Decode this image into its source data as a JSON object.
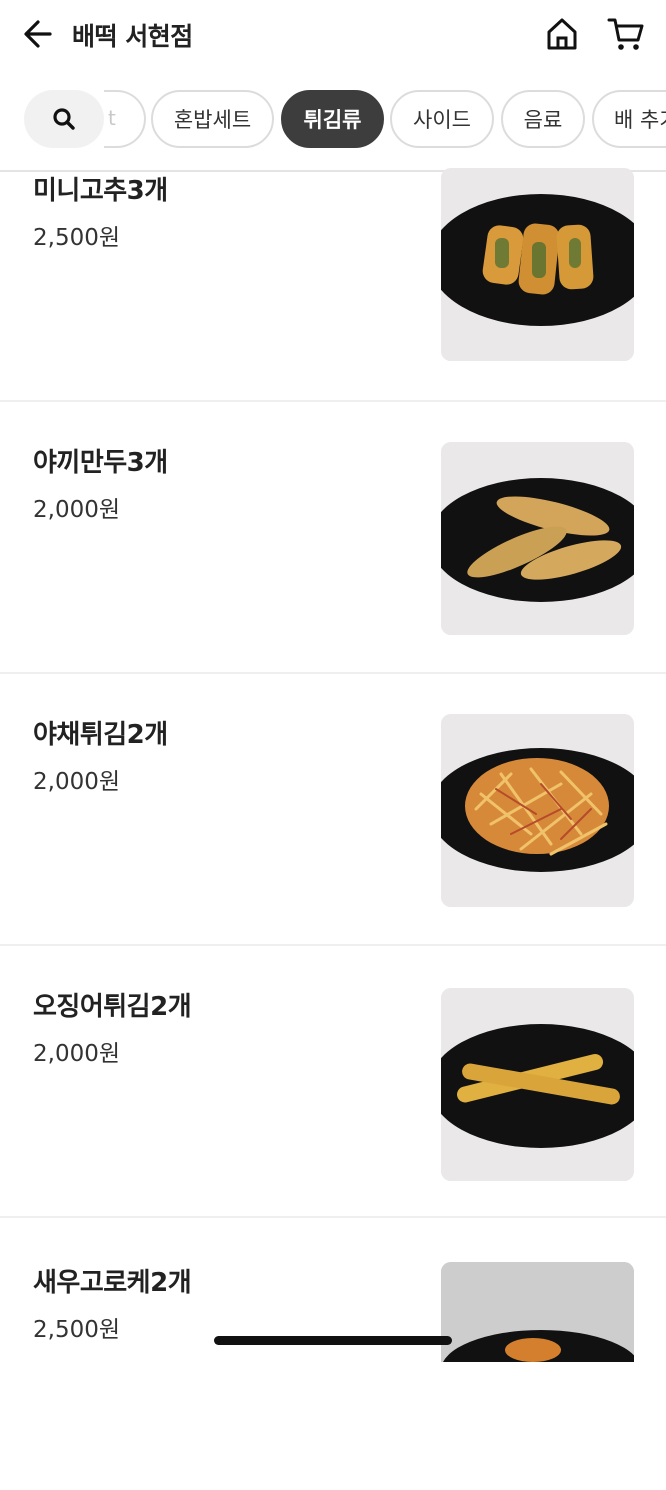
{
  "header": {
    "title": "배떡 서현점"
  },
  "tabs": {
    "partial_left_text": "t",
    "items": [
      "혼밥세트",
      "튀김류",
      "사이드",
      "음료",
      "배 추가"
    ],
    "active": "튀김류"
  },
  "menu": [
    {
      "name": "미니고추3개",
      "price": "2,500원",
      "image": "fried-mini-peppers"
    },
    {
      "name": "야끼만두3개",
      "price": "2,000원",
      "image": "fried-dumplings"
    },
    {
      "name": "야채튀김2개",
      "price": "2,000원",
      "image": "vegetable-fritter"
    },
    {
      "name": "오징어튀김2개",
      "price": "2,000원",
      "image": "fried-squid"
    },
    {
      "name": "새우고로케2개",
      "price": "2,500원",
      "image": "shrimp-croquette"
    }
  ],
  "colors": {
    "active_chip": "#3d3d3d",
    "plate": "#111111",
    "fry": "#d9a53a"
  }
}
